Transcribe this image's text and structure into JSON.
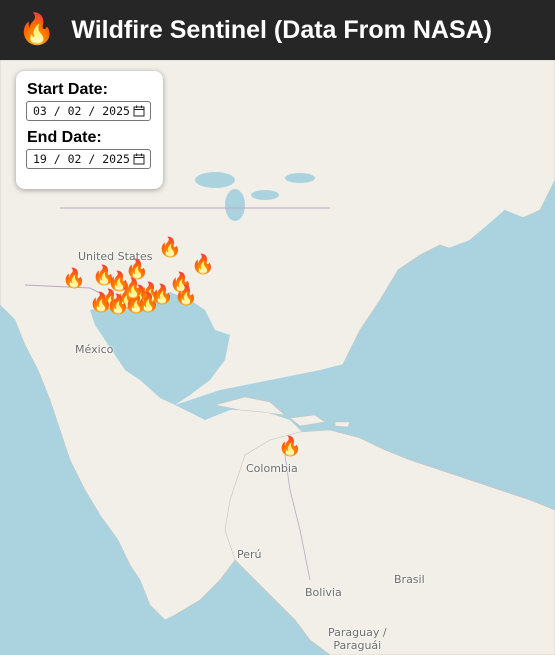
{
  "header": {
    "title": "Wildfire Sentinel (Data From NASA)",
    "logo_icon": "fire-icon"
  },
  "filters": {
    "start_label": "Start Date:",
    "start_value": "03 / 02 / 2025",
    "end_label": "End Date:",
    "end_value": "19 / 02 / 2025"
  },
  "map": {
    "labels": {
      "usa": "United States",
      "mexico": "México",
      "colombia": "Colombia",
      "peru": "Perú",
      "brasil": "Brasil",
      "bolivia": "Bolivia",
      "paraguay": "Paraguay /\nParaguái"
    },
    "fire_count": 19,
    "colors": {
      "water": "#aad3df",
      "land": "#f2efe9",
      "header": "#262626"
    }
  }
}
